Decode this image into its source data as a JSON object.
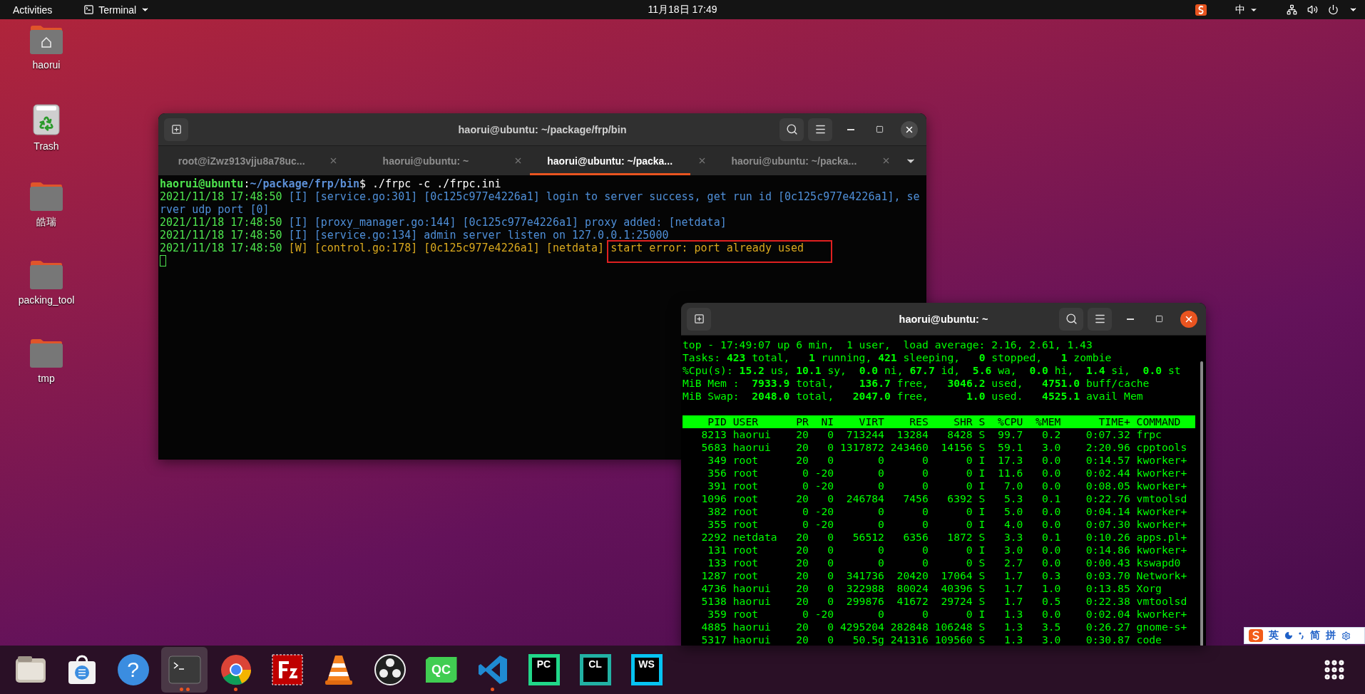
{
  "top_bar": {
    "activities": "Activities",
    "app_menu": "Terminal",
    "clock": "11月18日  17:49",
    "input_method": "中"
  },
  "desktop_icons": [
    {
      "label": "haorui",
      "kind": "home"
    },
    {
      "label": "Trash",
      "kind": "trash"
    },
    {
      "label": "皓瑞",
      "kind": "folder"
    },
    {
      "label": "packing_tool",
      "kind": "folder"
    },
    {
      "label": "tmp",
      "kind": "folder"
    }
  ],
  "terminal_window": {
    "title": "haorui@ubuntu: ~/package/frp/bin",
    "focused": false,
    "tabs": [
      {
        "label": "root@iZwz913vjju8a78uc...",
        "selected": false
      },
      {
        "label": "haorui@ubuntu: ~",
        "selected": false
      },
      {
        "label": "haorui@ubuntu: ~/packa...",
        "selected": true
      },
      {
        "label": "haorui@ubuntu: ~/packa...",
        "selected": false
      }
    ],
    "lines": [
      {
        "kind": "prompt",
        "user": "haorui@ubuntu",
        "separator": ":",
        "path": "~/package/frp/bin",
        "command": "$ ./frpc -c ./frpc.ini"
      },
      {
        "kind": "log",
        "segments": [
          {
            "kind": "timestamp",
            "text": "2021/11/18 17:48:50"
          },
          {
            "kind": "info",
            "text": " [I] [service.go:301] [0c125c977e4226a1] login to server success, get run id [0c125c977e4226a1], se"
          }
        ]
      },
      {
        "kind": "log",
        "segments": [
          {
            "kind": "info",
            "text": "rver udp port [0]"
          }
        ]
      },
      {
        "kind": "log",
        "segments": [
          {
            "kind": "timestamp",
            "text": "2021/11/18 17:48:50"
          },
          {
            "kind": "info",
            "text": " [I] [proxy_manager.go:144] [0c125c977e4226a1] proxy added: [netdata]"
          }
        ]
      },
      {
        "kind": "log",
        "segments": [
          {
            "kind": "timestamp",
            "text": "2021/11/18 17:48:50"
          },
          {
            "kind": "info",
            "text": " [I] [service.go:134] admin server listen on 127.0.0.1:25000"
          }
        ]
      },
      {
        "kind": "log",
        "segments": [
          {
            "kind": "timestamp",
            "text": "2021/11/18 17:48:50"
          },
          {
            "kind": "warning",
            "text": " [W] [control.go:178] [0c125c977e4226a1] [netdata] "
          },
          {
            "kind": "boxed_warning",
            "text": "start error: port already used"
          }
        ]
      },
      {
        "kind": "cursor"
      }
    ]
  },
  "top_window": {
    "title": "haorui@ubuntu: ~",
    "focused": true,
    "summary": [
      "top - 17:49:07 up 6 min,  1 user,  load average: 2.16, 2.61, 1.43",
      "Tasks: **423** total,   **1** running, **421** sleeping,   **0** stopped,   **1** zombie",
      "%Cpu(s): **15.2** us, **10.1** sy,  **0.0** ni, **67.7** id,  **5.6** wa,  **0.0** hi,  **1.4** si,  **0.0** st",
      "MiB Mem :  **7933.9** total,    **136.7** free,   **3046.2** used,   **4751.0** buff/cache",
      "MiB Swap:  **2048.0** total,   **2047.0** free,      **1.0** used.   **4525.1** avail Mem"
    ],
    "columns": [
      "PID",
      "USER",
      "PR",
      "NI",
      "VIRT",
      "RES",
      "SHR",
      "S",
      "%CPU",
      "%MEM",
      "TIME+",
      "COMMAND"
    ],
    "rows": [
      [
        "8213",
        "haorui",
        "20",
        "0",
        "713244",
        "13284",
        "8428",
        "S",
        "99.7",
        "0.2",
        "0:07.32",
        "frpc"
      ],
      [
        "5683",
        "haorui",
        "20",
        "0",
        "1317872",
        "243460",
        "14156",
        "S",
        "59.1",
        "3.0",
        "2:20.96",
        "cpptools"
      ],
      [
        "349",
        "root",
        "20",
        "0",
        "0",
        "0",
        "0",
        "I",
        "17.3",
        "0.0",
        "0:14.57",
        "kworker+"
      ],
      [
        "356",
        "root",
        "0",
        "-20",
        "0",
        "0",
        "0",
        "I",
        "11.6",
        "0.0",
        "0:02.44",
        "kworker+"
      ],
      [
        "391",
        "root",
        "0",
        "-20",
        "0",
        "0",
        "0",
        "I",
        "7.0",
        "0.0",
        "0:08.05",
        "kworker+"
      ],
      [
        "1096",
        "root",
        "20",
        "0",
        "246784",
        "7456",
        "6392",
        "S",
        "5.3",
        "0.1",
        "0:22.76",
        "vmtoolsd"
      ],
      [
        "382",
        "root",
        "0",
        "-20",
        "0",
        "0",
        "0",
        "I",
        "5.0",
        "0.0",
        "0:04.14",
        "kworker+"
      ],
      [
        "355",
        "root",
        "0",
        "-20",
        "0",
        "0",
        "0",
        "I",
        "4.0",
        "0.0",
        "0:07.30",
        "kworker+"
      ],
      [
        "2292",
        "netdata",
        "20",
        "0",
        "56512",
        "6356",
        "1872",
        "S",
        "3.3",
        "0.1",
        "0:10.26",
        "apps.pl+"
      ],
      [
        "131",
        "root",
        "20",
        "0",
        "0",
        "0",
        "0",
        "I",
        "3.0",
        "0.0",
        "0:14.86",
        "kworker+"
      ],
      [
        "133",
        "root",
        "20",
        "0",
        "0",
        "0",
        "0",
        "S",
        "2.7",
        "0.0",
        "0:00.43",
        "kswapd0"
      ],
      [
        "1287",
        "root",
        "20",
        "0",
        "341736",
        "20420",
        "17064",
        "S",
        "1.7",
        "0.3",
        "0:03.70",
        "Network+"
      ],
      [
        "4736",
        "haorui",
        "20",
        "0",
        "322988",
        "80024",
        "40396",
        "S",
        "1.7",
        "1.0",
        "0:13.85",
        "Xorg"
      ],
      [
        "5138",
        "haorui",
        "20",
        "0",
        "299876",
        "41672",
        "29724",
        "S",
        "1.7",
        "0.5",
        "0:22.38",
        "vmtoolsd"
      ],
      [
        "359",
        "root",
        "0",
        "-20",
        "0",
        "0",
        "0",
        "I",
        "1.3",
        "0.0",
        "0:02.04",
        "kworker+"
      ],
      [
        "4885",
        "haorui",
        "20",
        "0",
        "4295204",
        "282848",
        "106248",
        "S",
        "1.3",
        "3.5",
        "0:26.27",
        "gnome-s+"
      ],
      [
        "5317",
        "haorui",
        "20",
        "0",
        "50.5g",
        "241316",
        "109560",
        "S",
        "1.3",
        "3.0",
        "0:30.87",
        "code"
      ]
    ]
  },
  "ime_toolbar": [
    {
      "kind": "logo"
    },
    {
      "kind": "text",
      "text": "英"
    },
    {
      "kind": "moon"
    },
    {
      "kind": "punctuation"
    },
    {
      "kind": "text",
      "text": "简"
    },
    {
      "kind": "text",
      "text": "拼"
    },
    {
      "kind": "settings"
    }
  ],
  "dock": [
    {
      "kind": "files",
      "selected": false,
      "running": false
    },
    {
      "kind": "software",
      "selected": false,
      "running": false
    },
    {
      "kind": "help",
      "text": "?",
      "selected": false,
      "running": false
    },
    {
      "kind": "terminal",
      "selected": true,
      "running": true,
      "multiple_windows": true
    },
    {
      "kind": "chrome",
      "selected": false,
      "running": true,
      "multiple_windows": false
    },
    {
      "kind": "filezilla",
      "selected": false,
      "running": false
    },
    {
      "kind": "vlc",
      "selected": false,
      "running": false
    },
    {
      "kind": "obs",
      "selected": false,
      "running": false
    },
    {
      "kind": "qt",
      "text": "QC",
      "selected": false,
      "running": false
    },
    {
      "kind": "vscode",
      "selected": false,
      "running": true,
      "multiple_windows": false
    },
    {
      "kind": "jetbrains",
      "text": "PC",
      "color": "#21d789",
      "selected": false,
      "running": false
    },
    {
      "kind": "jetbrains",
      "text": "CL",
      "color": "#22b1a4",
      "selected": false,
      "running": false
    },
    {
      "kind": "jetbrains",
      "text": "WS",
      "color": "#07c3f2",
      "selected": false,
      "running": false
    }
  ]
}
